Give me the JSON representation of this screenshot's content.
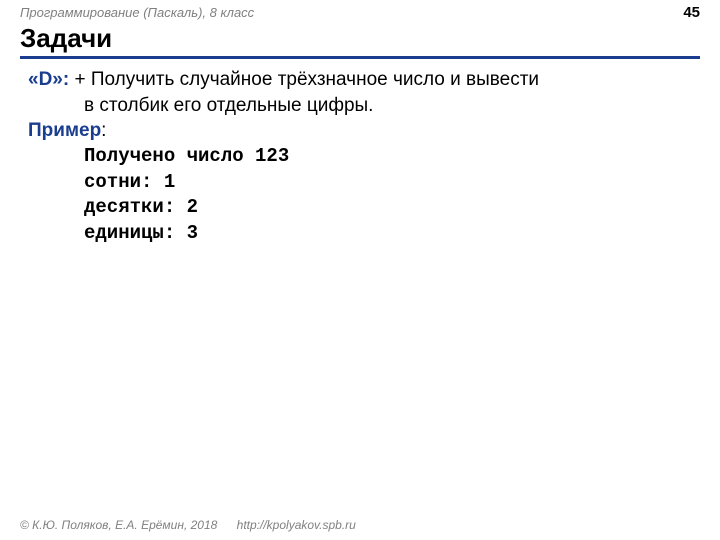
{
  "header": {
    "course": "Программирование (Паскаль), 8 класс",
    "page_number": "45"
  },
  "title": "Задачи",
  "task": {
    "label": "«D»:",
    "text_line1": " + Получить случайное трёхзначное число и вывести",
    "text_line2": "в столбик его отдельные цифры."
  },
  "example": {
    "label": "Пример",
    "colon": ":",
    "lines": [
      "Получено число 123",
      "сотни: 1",
      "десятки: 2",
      "единицы: 3"
    ]
  },
  "footer": {
    "copyright": "© К.Ю. Поляков, Е.А. Ерёмин, 2018",
    "url": "http://kpolyakov.spb.ru"
  }
}
